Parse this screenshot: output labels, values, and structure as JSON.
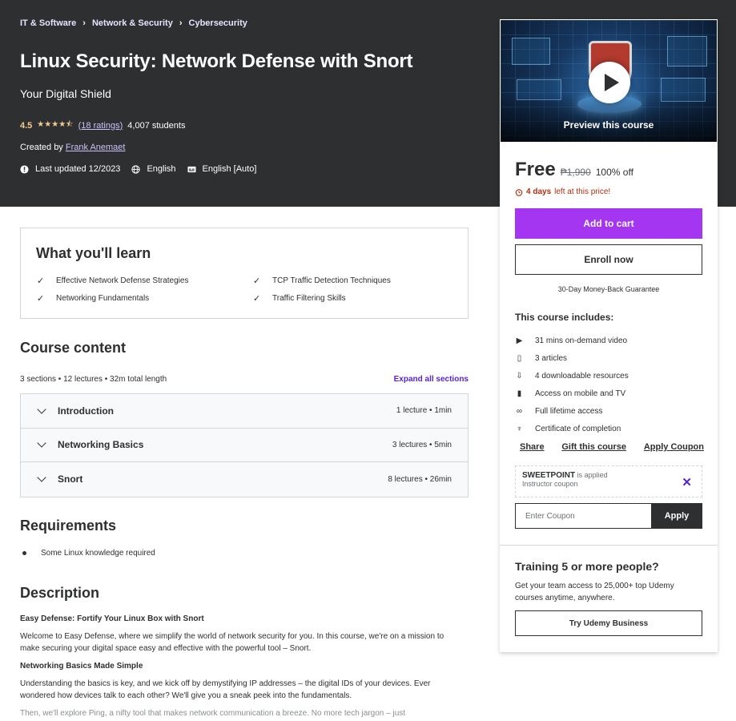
{
  "breadcrumb": [
    "IT & Software",
    "Network & Security",
    "Cybersecurity"
  ],
  "course": {
    "title": "Linux Security: Network Defense with Snort",
    "subtitle": "Your Digital Shield",
    "rating": "4.5",
    "rating_count": "(18 ratings)",
    "students": "4,007 students",
    "created_by_label": "Created by",
    "instructor": "Frank Anemaet",
    "last_updated": "Last updated 12/2023",
    "language": "English",
    "captions": "English [Auto]"
  },
  "sidebar": {
    "preview_label": "Preview this course",
    "price": "Free",
    "original_price": "₱1,990",
    "discount": "100% off",
    "deadline_bold": "4 days",
    "deadline_rest": "left at this price!",
    "add_to_cart": "Add to cart",
    "enroll": "Enroll now",
    "guarantee": "30-Day Money-Back Guarantee",
    "includes_title": "This course includes:",
    "includes": [
      {
        "icon": "video-icon",
        "glyph": "▶",
        "text": "31 mins on-demand video"
      },
      {
        "icon": "file-icon",
        "glyph": "▯",
        "text": "3 articles"
      },
      {
        "icon": "download-icon",
        "glyph": "⇩",
        "text": "4 downloadable resources"
      },
      {
        "icon": "mobile-icon",
        "glyph": "▮",
        "text": "Access on mobile and TV"
      },
      {
        "icon": "infinity-icon",
        "glyph": "∞",
        "text": "Full lifetime access"
      },
      {
        "icon": "trophy-icon",
        "glyph": "♆",
        "text": "Certificate of completion"
      }
    ],
    "links": {
      "share": "Share",
      "gift": "Gift this course",
      "apply_coupon": "Apply Coupon"
    },
    "coupon": {
      "code": "SWEETPOINT",
      "applied_text": "is applied",
      "source": "Instructor coupon",
      "placeholder": "Enter Coupon",
      "apply": "Apply"
    },
    "business": {
      "title": "Training 5 or more people?",
      "text": "Get your team access to 25,000+ top Udemy courses anytime, anywhere.",
      "button": "Try Udemy Business"
    }
  },
  "learn": {
    "title": "What you'll learn",
    "items": [
      "Effective Network Defense Strategies",
      "TCP Traffic Detection Techniques",
      "Networking Fundamentals",
      "Traffic Filtering Skills"
    ]
  },
  "content": {
    "title": "Course content",
    "summary": "3 sections • 12 lectures • 32m total length",
    "expand": "Expand all sections",
    "sections": [
      {
        "name": "Introduction",
        "info": "1 lecture • 1min"
      },
      {
        "name": "Networking Basics",
        "info": "3 lectures • 5min"
      },
      {
        "name": "Snort",
        "info": "8 lectures • 26min"
      }
    ]
  },
  "requirements": {
    "title": "Requirements",
    "items": [
      "Some Linux knowledge required"
    ]
  },
  "description": {
    "title": "Description",
    "heading1": "Easy Defense: Fortify Your Linux Box with Snort",
    "para1": "Welcome to Easy Defense, where we simplify the world of network security for you. In this course, we're on a mission to make securing your digital space easy and effective with the powerful tool – Snort.",
    "heading2": "Networking Basics Made Simple",
    "para2": "Understanding the basics is key, and we kick off by demystifying IP addresses – the digital IDs of your devices. Ever wondered how devices talk to each other? We'll give you a sneak peek into the fundamentals.",
    "para3": "Then, we'll explore Ping, a nifty tool that makes network communication a breeze. No more tech jargon – just"
  }
}
